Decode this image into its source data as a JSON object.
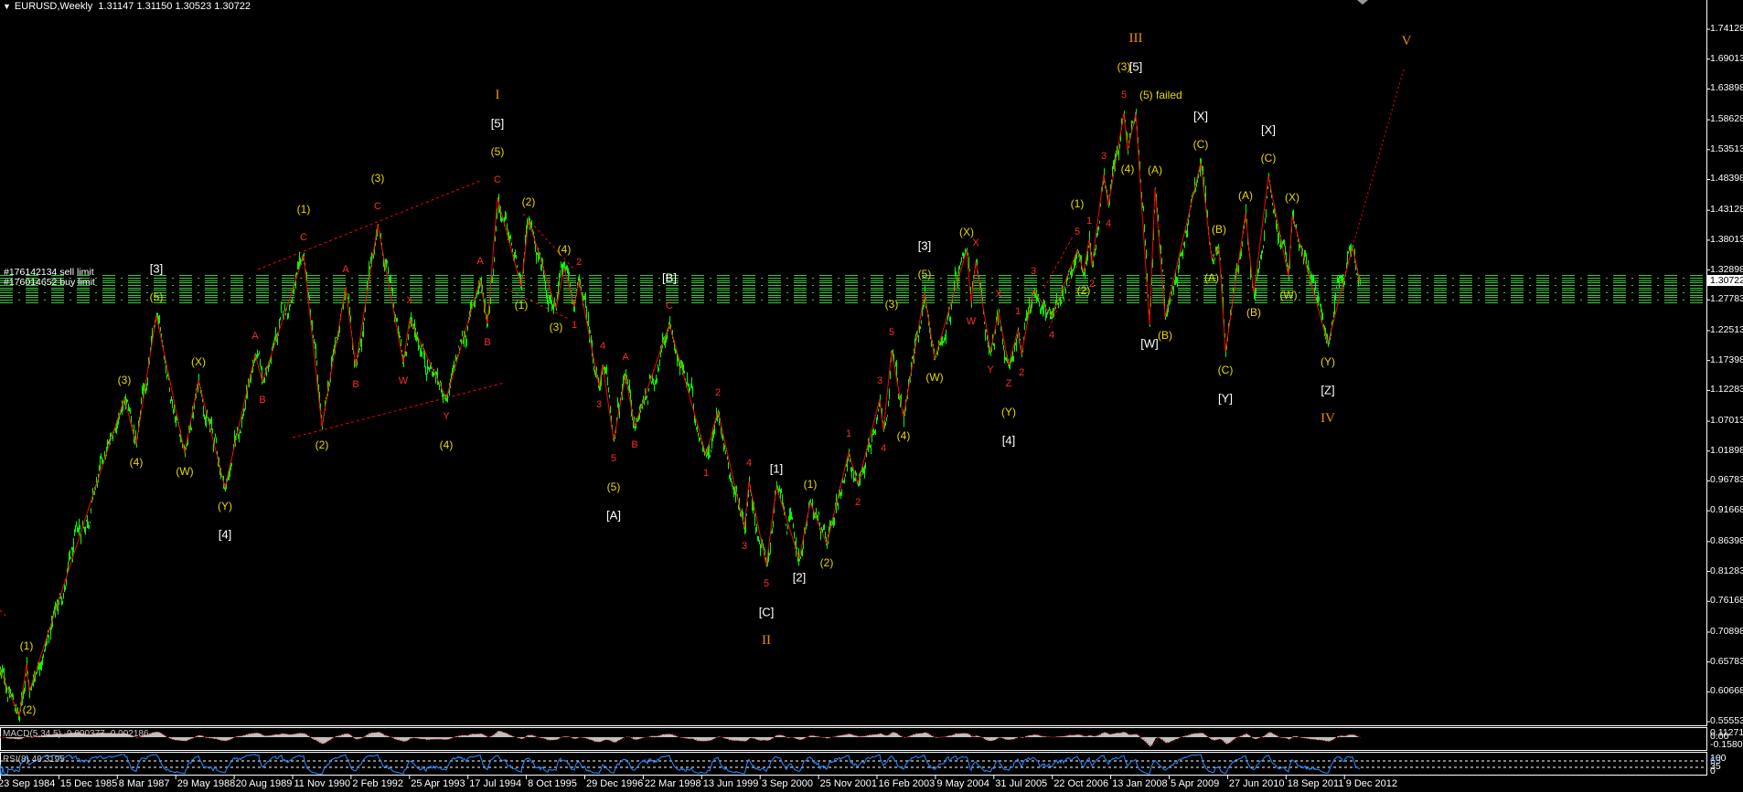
{
  "header": {
    "menu_icon": "triangle-down-icon",
    "symbol": "EURUSD,Weekly",
    "open": "1.31147",
    "high": "1.31150",
    "low": "1.30523",
    "close": "1.30722"
  },
  "orders": [
    {
      "label": "#176142134 sell limit",
      "price": 1.3158
    },
    {
      "label": "#176014652 buy limit",
      "price": 1.3033
    },
    {
      "label": "",
      "price": 1.2908
    },
    {
      "label": "",
      "price": 1.2783
    }
  ],
  "price_axis": {
    "ticks": [
      "1.74128",
      "1.69013",
      "1.63898",
      "1.58628",
      "1.53513",
      "1.48398",
      "1.43128",
      "1.38013",
      "1.32898",
      "1.27783",
      "1.22513",
      "1.17398",
      "1.12283",
      "1.07013",
      "1.01898",
      "0.96783",
      "0.91668",
      "0.86398",
      "0.81283",
      "0.76168",
      "0.70898",
      "0.65783",
      "0.60668",
      "0.55553"
    ],
    "current_price": "1.30722"
  },
  "indicators": {
    "macd": {
      "label": "MACD(5,34,5) -0.000377 -0.002186",
      "axis": [
        "0.11271",
        "0.00",
        "-0.15803"
      ]
    },
    "rsi": {
      "label": "RSI(8) 49.3195",
      "axis": [
        "100",
        "65",
        "35",
        "0"
      ]
    }
  },
  "time_axis": [
    "23 Sep 1984",
    "15 Dec 1985",
    "8 Mar 1987",
    "29 May 1988",
    "20 Aug 1989",
    "11 Nov 1990",
    "2 Feb 1992",
    "25 Apr 1993",
    "17 Jul 1994",
    "8 Oct 1995",
    "29 Dec 1996",
    "22 Mar 1998",
    "13 Jun 1999",
    "3 Sep 2000",
    "25 Nov 2001",
    "16 Feb 2003",
    "9 May 2004",
    "31 Jul 2005",
    "22 Oct 2006",
    "13 Jan 2008",
    "5 Apr 2009",
    "27 Jun 2010",
    "18 Sep 2011",
    "9 Dec 2012"
  ],
  "colors": {
    "bars": "#00ff00",
    "wave_line": "#ff0000",
    "minor": "#ff2a2a",
    "intermediate": "#e8d800",
    "primary": "#ffffff",
    "cycle": "#f08c00",
    "orders": "#33cc33",
    "macd": "#c0c0c0",
    "rsi": "#2a8cff"
  },
  "chart_data": {
    "type": "line",
    "title": "EURUSD,Weekly",
    "xlabel": "",
    "ylabel": "",
    "x_unit": "weeks since 23 Sep 1984",
    "ylim": [
      0.55553,
      1.74128
    ],
    "pivots": [
      {
        "w": 0,
        "p": 0.6448,
        "l": []
      },
      {
        "w": 21,
        "p": 0.565,
        "l": []
      },
      {
        "w": 29,
        "p": 0.6541,
        "l": [
          "(1)"
        ]
      },
      {
        "w": 32,
        "p": 0.6072,
        "l": [
          "(2)"
        ]
      },
      {
        "w": 136,
        "p": 1.1094,
        "l": [
          "(3)"
        ]
      },
      {
        "w": 149,
        "p": 1.0311,
        "l": [
          "(4)"
        ]
      },
      {
        "w": 171,
        "p": 1.2517,
        "l": [
          "(5)",
          "[3]"
        ]
      },
      {
        "w": 202,
        "p": 1.0155,
        "l": [
          "(W)"
        ]
      },
      {
        "w": 217,
        "p": 1.1406,
        "l": [
          "(X)"
        ]
      },
      {
        "w": 246,
        "p": 0.956,
        "l": [
          "(Y)",
          "[4]"
        ]
      },
      {
        "w": 279,
        "p": 1.1844,
        "l": [
          "A"
        ]
      },
      {
        "w": 287,
        "p": 1.1375,
        "l": [
          "B"
        ]
      },
      {
        "w": 332,
        "p": 1.3534,
        "l": [
          "C",
          "(1)"
        ]
      },
      {
        "w": 352,
        "p": 1.0609,
        "l": [
          "(2)"
        ]
      },
      {
        "w": 378,
        "p": 1.2986,
        "l": [
          "A"
        ]
      },
      {
        "w": 389,
        "p": 1.1641,
        "l": [
          "B"
        ]
      },
      {
        "w": 413,
        "p": 1.4066,
        "l": [
          "C",
          "(3)"
        ]
      },
      {
        "w": 441,
        "p": 1.1704,
        "l": [
          "W"
        ]
      },
      {
        "w": 448,
        "p": 1.2454,
        "l": [
          "X"
        ]
      },
      {
        "w": 488,
        "p": 1.1094,
        "l": [
          "Y",
          "(4)"
        ]
      },
      {
        "w": 525,
        "p": 1.3127,
        "l": [
          "A"
        ]
      },
      {
        "w": 533,
        "p": 1.2361,
        "l": [
          "B"
        ]
      },
      {
        "w": 544,
        "p": 1.4519,
        "l": [
          "C",
          "(5)",
          "[5]",
          "I"
        ]
      },
      {
        "w": 570,
        "p": 1.3002,
        "l": [
          "(1)"
        ]
      },
      {
        "w": 578,
        "p": 1.4144,
        "l": [
          "(2)"
        ]
      },
      {
        "w": 608,
        "p": 1.2626,
        "l": [
          "(3)"
        ]
      },
      {
        "w": 617,
        "p": 1.333,
        "l": [
          "(4)"
        ]
      },
      {
        "w": 628,
        "p": 1.2657,
        "l": [
          "1"
        ]
      },
      {
        "w": 633,
        "p": 1.3111,
        "l": [
          "2"
        ]
      },
      {
        "w": 655,
        "p": 1.1297,
        "l": [
          "3"
        ]
      },
      {
        "w": 659,
        "p": 1.1672,
        "l": [
          "4"
        ]
      },
      {
        "w": 671,
        "p": 1.0374,
        "l": [
          "5",
          "(5)",
          "[A]"
        ]
      },
      {
        "w": 684,
        "p": 1.1485,
        "l": [
          "A"
        ]
      },
      {
        "w": 694,
        "p": 1.0609,
        "l": [
          "B"
        ]
      },
      {
        "w": 732,
        "p": 1.2361,
        "l": [
          "C",
          "[B]"
        ]
      },
      {
        "w": 772,
        "p": 1.0124,
        "l": [
          "1"
        ]
      },
      {
        "w": 785,
        "p": 1.0875,
        "l": [
          "2"
        ]
      },
      {
        "w": 814,
        "p": 0.8872,
        "l": [
          "3"
        ]
      },
      {
        "w": 819,
        "p": 0.967,
        "l": [
          "4"
        ]
      },
      {
        "w": 838,
        "p": 0.8231,
        "l": [
          "5",
          "[C]",
          "II"
        ]
      },
      {
        "w": 849,
        "p": 0.9576,
        "l": [
          "[1]"
        ]
      },
      {
        "w": 874,
        "p": 0.834,
        "l": [
          "[2]"
        ]
      },
      {
        "w": 886,
        "p": 0.931,
        "l": [
          "(1)"
        ]
      },
      {
        "w": 904,
        "p": 0.8591,
        "l": [
          "(2)"
        ]
      },
      {
        "w": 928,
        "p": 1.0171,
        "l": [
          "1"
        ]
      },
      {
        "w": 938,
        "p": 0.9623,
        "l": [
          "2"
        ]
      },
      {
        "w": 962,
        "p": 1.1078,
        "l": [
          "3"
        ]
      },
      {
        "w": 966,
        "p": 1.0546,
        "l": [
          "4"
        ]
      },
      {
        "w": 975,
        "p": 1.1907,
        "l": [
          "5",
          "(3)"
        ]
      },
      {
        "w": 988,
        "p": 1.0765,
        "l": [
          "(4)"
        ]
      },
      {
        "w": 1011,
        "p": 1.2908,
        "l": [
          "(5)",
          "[3]"
        ]
      },
      {
        "w": 1022,
        "p": 1.1766,
        "l": [
          "(W)"
        ]
      },
      {
        "w": 1057,
        "p": 1.3628,
        "l": [
          "(X)"
        ]
      },
      {
        "w": 1062,
        "p": 1.272,
        "l": [
          "W"
        ]
      },
      {
        "w": 1067,
        "p": 1.344,
        "l": [
          "X"
        ]
      },
      {
        "w": 1083,
        "p": 1.1891,
        "l": [
          "Y"
        ]
      },
      {
        "w": 1092,
        "p": 1.2564,
        "l": [
          "X"
        ]
      },
      {
        "w": 1103,
        "p": 1.1657,
        "l": [
          "Z",
          "(Y)",
          "[4]"
        ]
      },
      {
        "w": 1113,
        "p": 1.2267,
        "l": [
          "1"
        ]
      },
      {
        "w": 1117,
        "p": 1.1844,
        "l": [
          "2"
        ]
      },
      {
        "w": 1130,
        "p": 1.2955,
        "l": [
          "3"
        ]
      },
      {
        "w": 1150,
        "p": 1.2486,
        "l": [
          "4"
        ]
      },
      {
        "w": 1178,
        "p": 1.3628,
        "l": [
          "5",
          "(1)"
        ]
      },
      {
        "w": 1185,
        "p": 1.3252,
        "l": [
          "(2)"
        ]
      },
      {
        "w": 1191,
        "p": 1.3815,
        "l": [
          "1"
        ]
      },
      {
        "w": 1194,
        "p": 1.3362,
        "l": [
          "2"
        ]
      },
      {
        "w": 1207,
        "p": 1.4926,
        "l": [
          "3"
        ]
      },
      {
        "w": 1212,
        "p": 1.4394,
        "l": [
          "4"
        ]
      },
      {
        "w": 1229,
        "p": 1.5974,
        "l": [
          "5",
          "(3)"
        ]
      },
      {
        "w": 1233,
        "p": 1.5333,
        "l": [
          "(4)"
        ]
      },
      {
        "w": 1242,
        "p": 1.5974,
        "l": [
          "(5) failed",
          "[5]",
          "III"
        ]
      },
      {
        "w": 1257,
        "p": 1.2345,
        "l": [
          "[W]"
        ]
      },
      {
        "w": 1263,
        "p": 1.4691,
        "l": [
          "(A)"
        ]
      },
      {
        "w": 1274,
        "p": 1.2486,
        "l": [
          "(B)"
        ]
      },
      {
        "w": 1313,
        "p": 1.5129,
        "l": [
          "(C)",
          "[X]"
        ]
      },
      {
        "w": 1325,
        "p": 1.3471,
        "l": [
          "(A)"
        ]
      },
      {
        "w": 1333,
        "p": 1.3675,
        "l": [
          "(B)"
        ]
      },
      {
        "w": 1340,
        "p": 1.1891,
        "l": [
          "(C)",
          "[Y]"
        ]
      },
      {
        "w": 1362,
        "p": 1.4253,
        "l": [
          "(A)"
        ]
      },
      {
        "w": 1371,
        "p": 1.2877,
        "l": [
          "(B)"
        ]
      },
      {
        "w": 1387,
        "p": 1.4895,
        "l": [
          "(C)",
          "[X]"
        ]
      },
      {
        "w": 1409,
        "p": 1.3174,
        "l": [
          "(W)"
        ]
      },
      {
        "w": 1413,
        "p": 1.4222,
        "l": [
          "(X)"
        ]
      },
      {
        "w": 1452,
        "p": 1.2032,
        "l": [
          "(Y)",
          "[Z]",
          "IV"
        ]
      },
      {
        "w": 1479,
        "p": 1.369,
        "l": []
      },
      {
        "w": 1487,
        "p": 1.30722,
        "l": []
      }
    ],
    "projection": {
      "from": {
        "w": 1479,
        "p": 1.369
      },
      "to": {
        "w": 1535,
        "p": 1.6725
      },
      "label": "V"
    },
    "trendlines": [
      [
        {
          "w": 282,
          "p": 1.3299
        },
        {
          "w": 525,
          "p": 1.4816
        }
      ],
      [
        {
          "w": 320,
          "p": 1.0421
        },
        {
          "w": 552,
          "p": 1.136
        }
      ],
      [
        {
          "w": 572,
          "p": 1.4253
        },
        {
          "w": 627,
          "p": 1.3315
        }
      ],
      [
        {
          "w": 553,
          "p": 1.297
        },
        {
          "w": 622,
          "p": 1.2454
        }
      ],
      [
        {
          "w": 1142,
          "p": 1.2986
        },
        {
          "w": 1173,
          "p": 1.3862
        }
      ],
      [
        {
          "w": 1147,
          "p": 1.2298
        },
        {
          "w": 1180,
          "p": 1.344
        }
      ],
      [
        {
          "w": 0,
          "p": 0.7464
        },
        {
          "w": 8,
          "p": 0.7339
        }
      ]
    ]
  }
}
